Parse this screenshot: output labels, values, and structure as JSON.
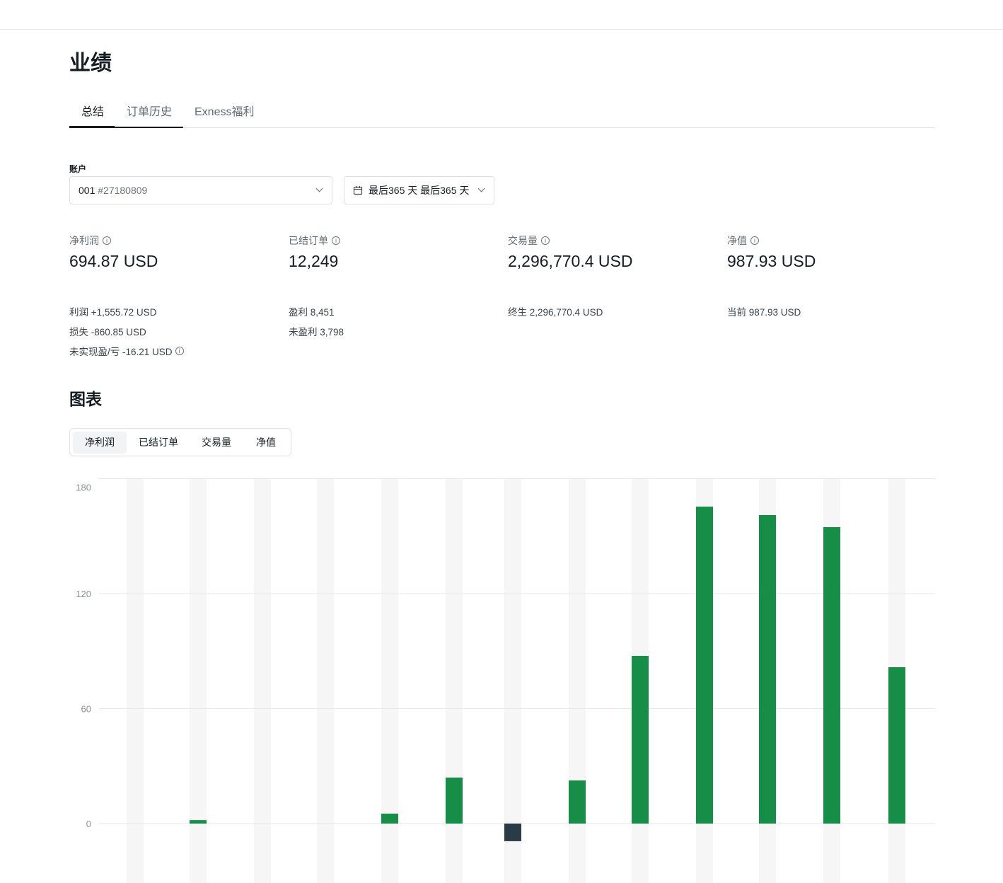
{
  "page": {
    "title": "业绩"
  },
  "tabs": [
    {
      "label": "总结"
    },
    {
      "label": "订单历史"
    },
    {
      "label": "Exness福利"
    }
  ],
  "account": {
    "label": "账户",
    "number": "001",
    "id": "#27180809",
    "range": "最后365 天 最后365 天"
  },
  "metrics": [
    {
      "label": "净利润",
      "value": "694.87 USD",
      "details": [
        "利润 +1,555.72 USD",
        "损失 -860.85 USD",
        "未实现盈/亏 -16.21 USD"
      ]
    },
    {
      "label": "已结订单",
      "value": "12,249",
      "details": [
        "盈利 8,451",
        "未盈利 3,798"
      ]
    },
    {
      "label": "交易量",
      "value": "2,296,770.4 USD",
      "details": [
        "终生 2,296,770.4 USD"
      ]
    },
    {
      "label": "净值",
      "value": "987.93 USD",
      "details": [
        "当前 987.93 USD"
      ]
    }
  ],
  "charts": {
    "title": "图表",
    "segments": [
      {
        "label": "净利润"
      },
      {
        "label": "已结订单"
      },
      {
        "label": "交易量"
      },
      {
        "label": "净值"
      }
    ]
  },
  "info_icon": "ⓘ",
  "chart_data": {
    "type": "bar",
    "title": "净利润",
    "ylim": [
      -30,
      180
    ],
    "yticks": [
      0,
      60,
      120,
      180
    ],
    "grid": true,
    "values": [
      0,
      1.8,
      0,
      0,
      5.2,
      24,
      -9.2,
      22.5,
      87.5,
      165.4,
      161,
      154.7,
      81.6
    ],
    "colors": {
      "positive": "#168e48",
      "negative": "#2a3b48",
      "track": "#f6f6f6"
    }
  }
}
